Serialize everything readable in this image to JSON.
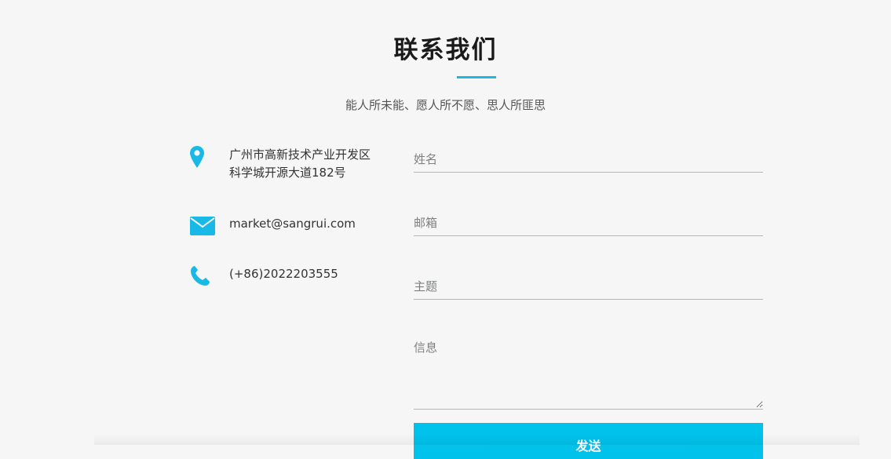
{
  "header": {
    "title": "联系我们",
    "subtitle": "能人所未能、愿人所不愿、思人所匪思"
  },
  "contact_info": {
    "address_line1": "广州市高新技术产业开发区",
    "address_line2": "科学城开源大道182号",
    "email": "market@sangrui.com",
    "phone": "(+86)2022203555",
    "icons": [
      "location-pin-icon",
      "envelope-icon",
      "phone-icon"
    ]
  },
  "form": {
    "name_placeholder": "姓名",
    "email_placeholder": "邮箱",
    "subject_placeholder": "主题",
    "message_placeholder": "信息",
    "send_label": "发送"
  },
  "colors": {
    "accent": "#18b9e6",
    "button": "#00c2ea",
    "background": "#f6f6f6"
  }
}
